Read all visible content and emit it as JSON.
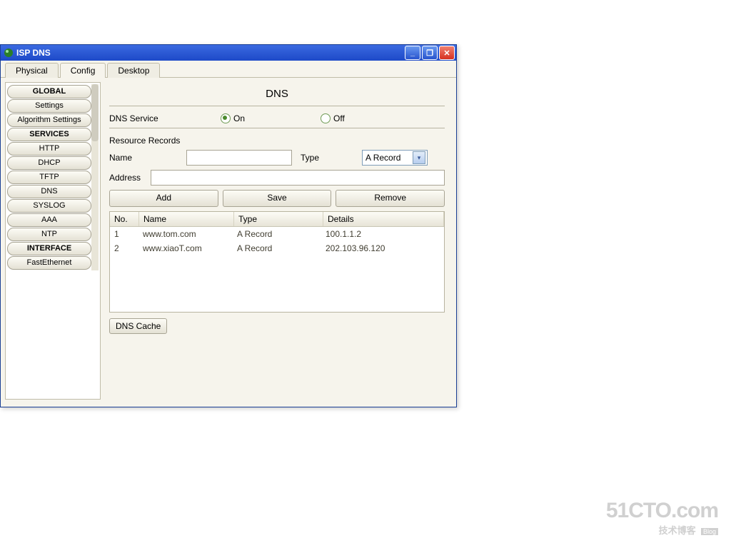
{
  "titlebar": {
    "title": "ISP DNS"
  },
  "tabs": {
    "t0": "Physical",
    "t1": "Config",
    "t2": "Desktop"
  },
  "sidebar": {
    "head_global": "GLOBAL",
    "settings": "Settings",
    "algo": "Algorithm Settings",
    "head_services": "SERVICES",
    "http": "HTTP",
    "dhcp": "DHCP",
    "tftp": "TFTP",
    "dns": "DNS",
    "syslog": "SYSLOG",
    "aaa": "AAA",
    "ntp": "NTP",
    "head_interface": "INTERFACE",
    "fe": "FastEthernet"
  },
  "dns": {
    "title": "DNS",
    "service_label": "DNS Service",
    "on": "On",
    "off": "Off",
    "service_value": "on",
    "rr_label": "Resource Records",
    "name_label": "Name",
    "name_value": "",
    "type_label": "Type",
    "type_value": "A Record",
    "address_label": "Address",
    "address_value": "",
    "add": "Add",
    "save": "Save",
    "remove": "Remove",
    "cache_btn": "DNS Cache",
    "columns": {
      "no": "No.",
      "name": "Name",
      "type": "Type",
      "details": "Details"
    },
    "rows": [
      {
        "no": "1",
        "name": "www.tom.com",
        "type": "A Record",
        "details": "100.1.1.2"
      },
      {
        "no": "2",
        "name": "www.xiaoT.com",
        "type": "A Record",
        "details": "202.103.96.120"
      }
    ]
  },
  "watermark": {
    "big": "51CTO.com",
    "sub": "技术博客",
    "tag": "Blog"
  }
}
